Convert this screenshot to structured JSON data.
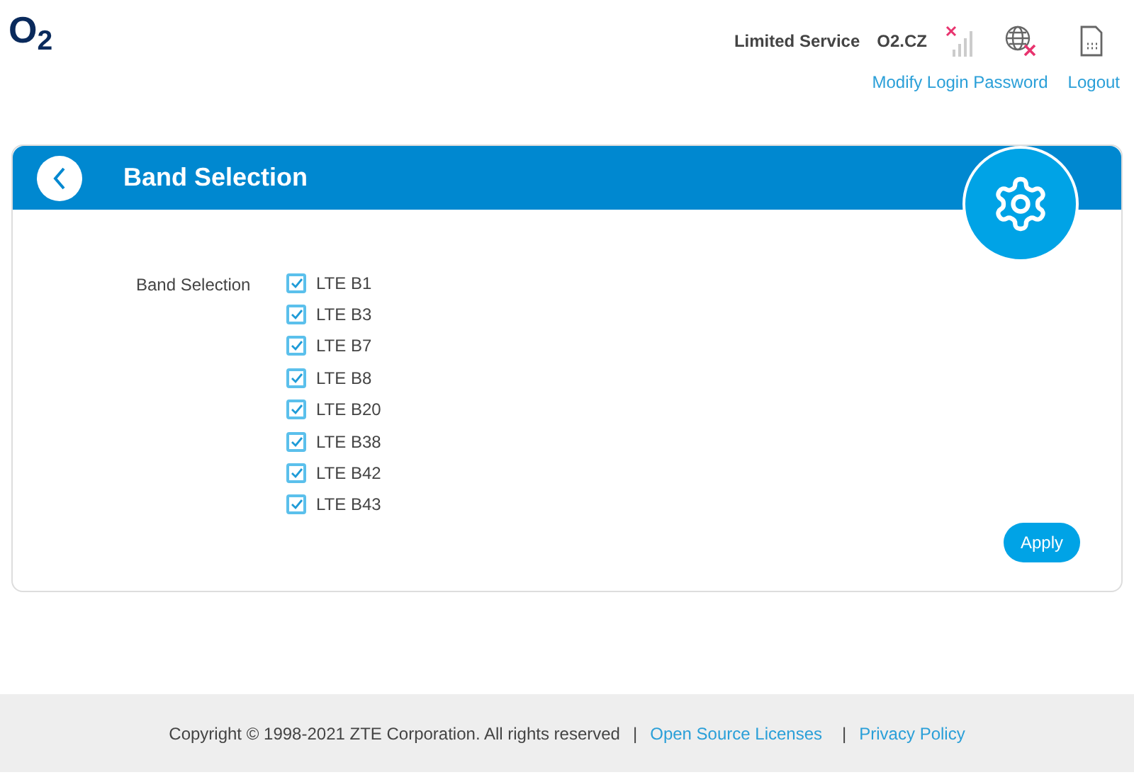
{
  "header": {
    "logo": "O$_{2}$",
    "status": "Limited Service",
    "operator": "O2.CZ",
    "links": [
      "Modify Login Password",
      "Logout"
    ]
  },
  "card": {
    "title": "Band Selection",
    "field_label": "Band Selection",
    "bands": [
      {
        "label": "LTE B1",
        "checked": true
      },
      {
        "label": "LTE B3",
        "checked": true
      },
      {
        "label": "LTE B7",
        "checked": true
      },
      {
        "label": "LTE B8",
        "checked": true
      },
      {
        "label": "LTE B20",
        "checked": true
      },
      {
        "label": "LTE B38",
        "checked": true
      },
      {
        "label": "LTE B42",
        "checked": true
      },
      {
        "label": "LTE B43",
        "checked": true
      }
    ],
    "apply": "Apply"
  },
  "footer": {
    "copyright": "Copyright © 1998-2021 ZTE Corporation. All rights reserved",
    "separator_1": "|",
    "link_1": "Open Source Licenses",
    "separator_2": "|",
    "link_2": "Privacy Policy"
  }
}
